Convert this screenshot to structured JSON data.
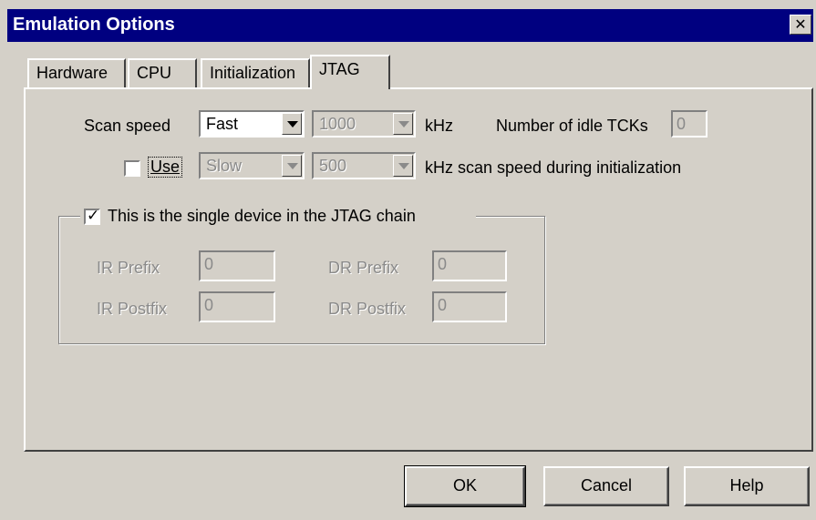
{
  "window": {
    "title": "Emulation Options",
    "close_glyph": "✕"
  },
  "tabs": [
    {
      "label": "Hardware"
    },
    {
      "label": "CPU"
    },
    {
      "label": "Initialization"
    },
    {
      "label": "JTAG"
    }
  ],
  "jtag": {
    "scan_speed_label": "Scan speed",
    "scan_speed_value": "Fast",
    "freq_value": "1000",
    "khz_label": "kHz",
    "idle_tcks_label": "Number of idle TCKs",
    "idle_tcks_value": "0",
    "use_label": "Use",
    "use_checked": false,
    "init_speed_value": "Slow",
    "init_freq_value": "500",
    "init_khz_label": "kHz  scan speed during initialization",
    "single_device_label": "This is the single device in the JTAG chain",
    "single_device_checked": true,
    "ir_prefix_label": "IR Prefix",
    "ir_prefix_value": "0",
    "dr_prefix_label": "DR Prefix",
    "dr_prefix_value": "0",
    "ir_postfix_label": "IR Postfix",
    "ir_postfix_value": "0",
    "dr_postfix_label": "DR Postfix",
    "dr_postfix_value": "0"
  },
  "buttons": {
    "ok": "OK",
    "cancel": "Cancel",
    "help": "Help"
  },
  "colors": {
    "titlebar": "#000080",
    "face": "#d4d0c8",
    "disabled_text": "#8a8a8a"
  }
}
